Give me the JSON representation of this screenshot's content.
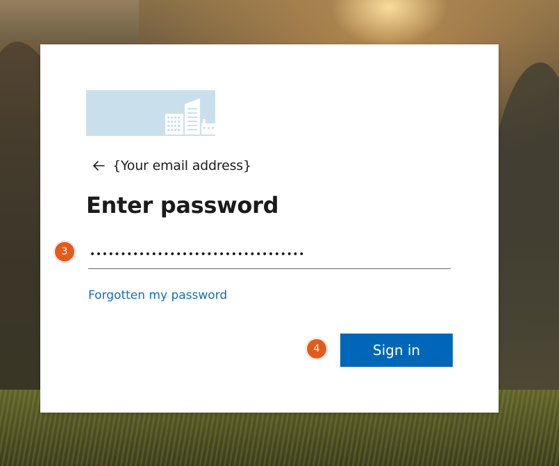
{
  "card": {
    "identity": "{Your email address}",
    "title": "Enter password",
    "password_value": "•••••••••••••••••••••••••••••••••••",
    "forgot_link": "Forgotten my password",
    "signin_label": "Sign in"
  },
  "badges": {
    "step_3": "3",
    "step_4": "4"
  },
  "icons": {
    "back": "arrow-left-icon",
    "logo": "building-logo-icon"
  },
  "colors": {
    "accent": "#0067b8",
    "link": "#0f6cbd",
    "badge": "#e35b1b",
    "logo_bg": "#c9e0ec"
  }
}
